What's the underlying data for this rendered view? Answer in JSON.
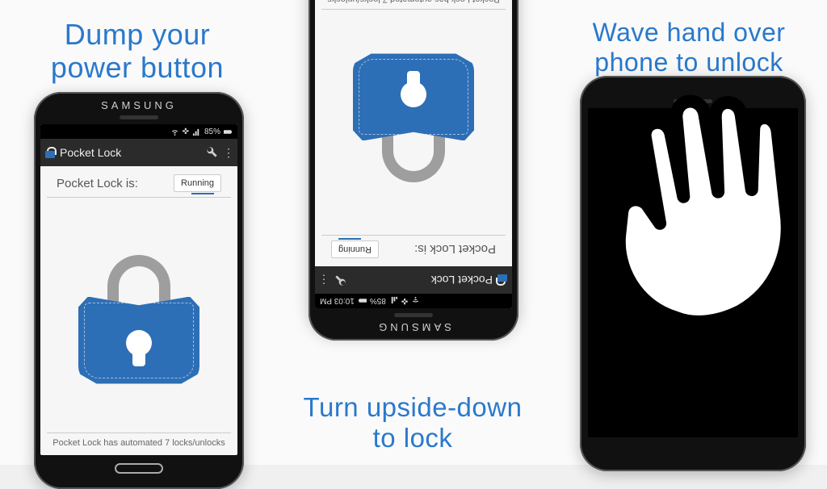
{
  "panels": [
    {
      "caption": "Dump your\npower button"
    },
    {
      "caption": "Turn upside-down\nto lock"
    },
    {
      "caption": "Wave hand over\nphone to unlock"
    }
  ],
  "device": {
    "brand": "SAMSUNG"
  },
  "statusbar": {
    "battery_pct": "85%",
    "clock": "10:03 PM"
  },
  "app": {
    "title": "Pocket Lock",
    "status_label": "Pocket Lock is:",
    "status_value": "Running",
    "footer": "Pocket Lock has automated 7 locks/unlocks"
  }
}
